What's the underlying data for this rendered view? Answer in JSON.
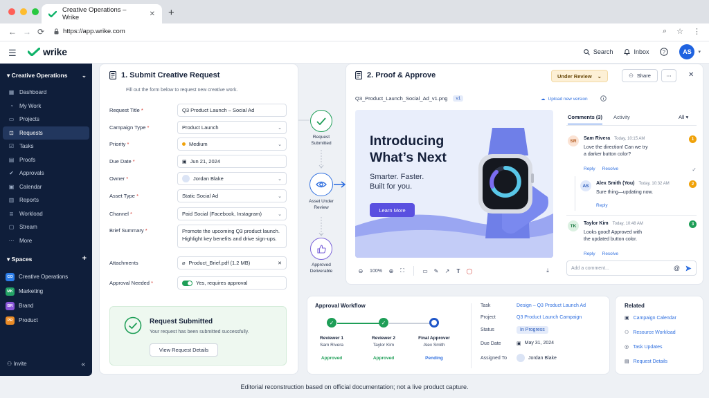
{
  "browser": {
    "tab_title": "Creative Operations – Wrike",
    "url": "https://app.wrike.com",
    "new_tab": "+",
    "close": "✕"
  },
  "app": {
    "logo_text": "wrike",
    "search": "Search",
    "inbox": "Inbox",
    "avatar": "AS"
  },
  "sidebar": {
    "workspace": "Creative Operations",
    "items": [
      {
        "label": "Dashboard",
        "icon": "grid-icon"
      },
      {
        "label": "My Work",
        "icon": "user-icon"
      },
      {
        "label": "Projects",
        "icon": "folder-icon"
      },
      {
        "label": "Requests",
        "icon": "inbox-icon"
      },
      {
        "label": "Tasks",
        "icon": "check-icon"
      },
      {
        "label": "Proofs",
        "icon": "document-icon"
      },
      {
        "label": "Approvals",
        "icon": "approve-icon"
      },
      {
        "label": "Calendar",
        "icon": "calendar-icon"
      },
      {
        "label": "Reports",
        "icon": "chart-icon"
      },
      {
        "label": "Workload",
        "icon": "bars-icon"
      },
      {
        "label": "Stream",
        "icon": "stream-icon"
      },
      {
        "label": "More",
        "icon": "more-icon"
      }
    ],
    "spaces_title": "Spaces",
    "spaces": [
      {
        "badge": "CO",
        "label": "Creative Operations",
        "color": "#2b7de9"
      },
      {
        "badge": "MK",
        "label": "Marketing",
        "color": "#23a266"
      },
      {
        "badge": "BR",
        "label": "Brand",
        "color": "#8a56d8"
      },
      {
        "badge": "PR",
        "label": "Product",
        "color": "#e98a25"
      }
    ],
    "invite": "Invite"
  },
  "form": {
    "title": "1. Submit Creative Request",
    "subtitle": "Fill out the form below to request new creative work.",
    "fields": {
      "request_title": {
        "label": "Request Title",
        "value": "Q3 Product Launch – Social Ad"
      },
      "campaign_type": {
        "label": "Campaign Type",
        "value": "Product Launch"
      },
      "priority": {
        "label": "Priority",
        "value": "Medium"
      },
      "due_date": {
        "label": "Due Date",
        "value": "Jun 21, 2024"
      },
      "owner": {
        "label": "Owner",
        "value": "Jordan Blake"
      },
      "asset_type": {
        "label": "Asset Type",
        "value": "Static Social Ad"
      },
      "channel": {
        "label": "Channel",
        "value": "Paid Social (Facebook, Instagram)"
      },
      "brief": {
        "label": "Brief Summary",
        "line1": "Promote the upcoming Q3 product launch.",
        "line2": "Highlight key benefits and drive sign-ups."
      },
      "attachments": {
        "label": "Attachments",
        "value": "Product_Brief.pdf (1.2 MB)"
      },
      "approval": {
        "label": "Approval Needed",
        "value": "Yes, requires approval"
      }
    },
    "required_mark": "*",
    "success": {
      "title": "Request Submitted",
      "message": "Your request has been submitted successfully.",
      "button": "View Request Details"
    }
  },
  "flow": {
    "submitted": [
      "Request",
      "Submitted"
    ],
    "review": [
      "Asset Under",
      "Review"
    ],
    "approved": [
      "Approved",
      "Deliverable"
    ]
  },
  "proof": {
    "title": "2. Proof & Approve",
    "status": "Under Review",
    "share": "Share",
    "more": "⋯",
    "filename": "Q3_Product_Launch_Social_Ad_v1.png",
    "version": "v1",
    "upload": "Upload new version",
    "creative": {
      "headline1": "Introducing",
      "headline2": "What’s Next",
      "sub1": "Smarter. Faster.",
      "sub2": "Built for you.",
      "cta": "Learn More"
    },
    "zoom": "100%",
    "tabs": {
      "comments": "Comments",
      "count": "(3)",
      "activity": "Activity",
      "filter": "All"
    },
    "comments": [
      {
        "initials": "SR",
        "name": "Sam Rivera",
        "time": "Today, 10:15 AM",
        "line1": "Love the direction! Can we try",
        "line2": "a darker button color?",
        "num": "1",
        "num_color": "#f0a20a",
        "av_bg": "#fbe3d4",
        "av_fg": "#b35a1e"
      },
      {
        "initials": "AS",
        "name": "Alex Smith (You)",
        "time": "Today, 10:32 AM",
        "line1": "Sure thing—updating now.",
        "line2": "",
        "num": "2",
        "num_color": "#f0a20a",
        "av_bg": "#dfe8fb",
        "av_fg": "#2456b8"
      },
      {
        "initials": "TK",
        "name": "Taylor Kim",
        "time": "Today, 10:48 AM",
        "line1": "Looks good! Approved with",
        "line2": "the updated button color.",
        "num": "3",
        "num_color": "#1e9e57",
        "av_bg": "#dcf1e2",
        "av_fg": "#1b7a43"
      }
    ],
    "reply": "Reply",
    "resolve": "Resolve",
    "comment_placeholder": "Add a comment..."
  },
  "workflow": {
    "title": "Approval Workflow",
    "steps": [
      {
        "role": "Reviewer 1",
        "person": "Sam Rivera",
        "status": "Approved"
      },
      {
        "role": "Reviewer 2",
        "person": "Taylor Kim",
        "status": "Approved"
      },
      {
        "role": "Final Approver",
        "person": "Alex Smith",
        "status": "Pending"
      }
    ],
    "details": {
      "task_k": "Task",
      "task_v": "Design – Q3 Product Launch Ad",
      "project_k": "Project",
      "project_v": "Q3 Product Launch Campaign",
      "status_k": "Status",
      "status_v": "In Progress",
      "due_k": "Due Date",
      "due_v": "May 31, 2024",
      "assigned_k": "Assigned To",
      "assigned_v": "Jordan Blake"
    }
  },
  "related": {
    "title": "Related",
    "items": [
      "Campaign Calendar",
      "Resource Workload",
      "Task Updates",
      "Request Details"
    ]
  },
  "caption": "Editorial reconstruction based on official documentation; not a live product capture."
}
